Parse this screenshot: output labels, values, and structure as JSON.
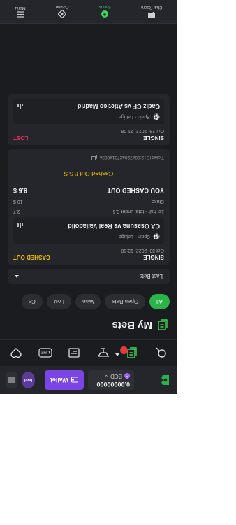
{
  "header": {
    "balance": "0.00000000",
    "currency": "BCD",
    "wallet_label": "Wallet",
    "avatar_text": "level"
  },
  "toolbar": {
    "icons": [
      "search-icon",
      "bet-slip-icon",
      "lobby-icon",
      "calendar-icon",
      "live-icon",
      "favorites-icon"
    ],
    "live_label": "LIVE"
  },
  "page": {
    "title": "My Bets"
  },
  "filters": [
    "All",
    "Open Bets",
    "Won",
    "Lost",
    "Ca"
  ],
  "dropdown": {
    "label": "Last Bets"
  },
  "bets": [
    {
      "type": "SINGLE",
      "date": "Oct 30, 2022, 13:50",
      "status": "CASHED OUT",
      "league": "Spain - LaLiga",
      "teams": "CA Osasuna vs Real Valladolid",
      "market": "1st half - total under 0.5",
      "odds": "2.7",
      "stake_label": "Stake",
      "stake": "10 $",
      "result_label": "YOU CASHED OUT",
      "result_amount": "8.5 $",
      "cashed_text": "Cashed Out 8.5 $",
      "ticket": "Ticket ID: 2:88a720a2701a083e"
    },
    {
      "type": "SINGLE",
      "date": "Oct 29, 2022, 21:08",
      "status": "LOST",
      "league": "Spain - LaLiga",
      "teams": "Cadiz CF vs Atletico Madrid"
    }
  ],
  "bottom_nav": [
    {
      "label": "Menu"
    },
    {
      "label": "Casino"
    },
    {
      "label": "Sports"
    },
    {
      "label": "Chat Room"
    }
  ],
  "colors": {
    "accent_green": "#2ab34a",
    "cashed": "#f2c200",
    "lost": "#e0325f",
    "wallet": "#7b45e6"
  }
}
